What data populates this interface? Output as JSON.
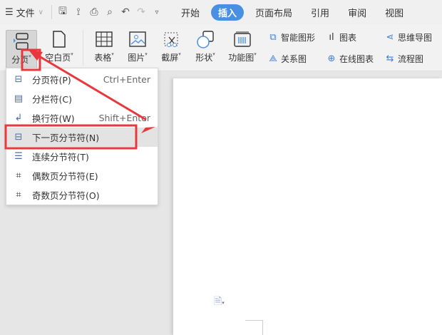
{
  "topbar": {
    "menu_label": "文件",
    "tabs": [
      {
        "label": "开始"
      },
      {
        "label": "插入",
        "active": true
      },
      {
        "label": "页面布局"
      },
      {
        "label": "引用"
      },
      {
        "label": "审阅"
      },
      {
        "label": "视图"
      }
    ]
  },
  "ribbon": {
    "big": [
      {
        "label": "分页"
      },
      {
        "label": "空白页"
      },
      {
        "label": "表格"
      },
      {
        "label": "图片"
      },
      {
        "label": "截屏"
      },
      {
        "label": "形状"
      },
      {
        "label": "功能图"
      }
    ],
    "small": [
      {
        "label": "智能图形"
      },
      {
        "label": "关系图"
      },
      {
        "label": "图表"
      },
      {
        "label": "在线图表"
      },
      {
        "label": "思维导图"
      },
      {
        "label": "流程图"
      }
    ]
  },
  "menu": {
    "items": [
      {
        "label": "分页符(P)",
        "shortcut": "Ctrl+Enter"
      },
      {
        "label": "分栏符(C)"
      },
      {
        "label": "换行符(W)",
        "shortcut": "Shift+Enter"
      },
      {
        "label": "下一页分节符(N)"
      },
      {
        "label": "连续分节符(T)"
      },
      {
        "label": "偶数页分节符(E)"
      },
      {
        "label": "奇数页分节符(O)"
      }
    ]
  },
  "colors": {
    "accent": "#4a90e2",
    "annotation": "#e8383d"
  }
}
